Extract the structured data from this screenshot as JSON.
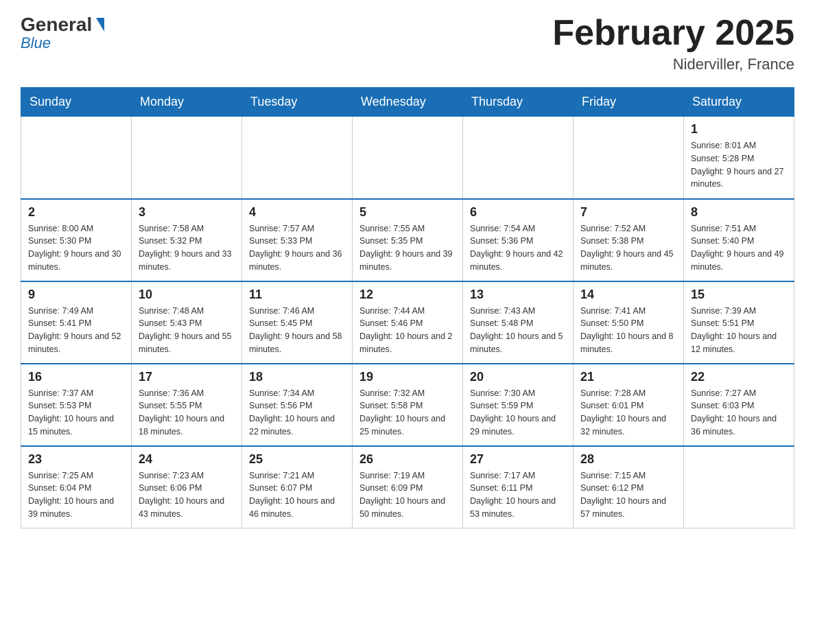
{
  "header": {
    "logo_general": "General",
    "logo_blue": "Blue",
    "month_title": "February 2025",
    "location": "Niderviller, France"
  },
  "weekdays": [
    "Sunday",
    "Monday",
    "Tuesday",
    "Wednesday",
    "Thursday",
    "Friday",
    "Saturday"
  ],
  "weeks": [
    [
      {
        "day": "",
        "info": ""
      },
      {
        "day": "",
        "info": ""
      },
      {
        "day": "",
        "info": ""
      },
      {
        "day": "",
        "info": ""
      },
      {
        "day": "",
        "info": ""
      },
      {
        "day": "",
        "info": ""
      },
      {
        "day": "1",
        "info": "Sunrise: 8:01 AM\nSunset: 5:28 PM\nDaylight: 9 hours and 27 minutes."
      }
    ],
    [
      {
        "day": "2",
        "info": "Sunrise: 8:00 AM\nSunset: 5:30 PM\nDaylight: 9 hours and 30 minutes."
      },
      {
        "day": "3",
        "info": "Sunrise: 7:58 AM\nSunset: 5:32 PM\nDaylight: 9 hours and 33 minutes."
      },
      {
        "day": "4",
        "info": "Sunrise: 7:57 AM\nSunset: 5:33 PM\nDaylight: 9 hours and 36 minutes."
      },
      {
        "day": "5",
        "info": "Sunrise: 7:55 AM\nSunset: 5:35 PM\nDaylight: 9 hours and 39 minutes."
      },
      {
        "day": "6",
        "info": "Sunrise: 7:54 AM\nSunset: 5:36 PM\nDaylight: 9 hours and 42 minutes."
      },
      {
        "day": "7",
        "info": "Sunrise: 7:52 AM\nSunset: 5:38 PM\nDaylight: 9 hours and 45 minutes."
      },
      {
        "day": "8",
        "info": "Sunrise: 7:51 AM\nSunset: 5:40 PM\nDaylight: 9 hours and 49 minutes."
      }
    ],
    [
      {
        "day": "9",
        "info": "Sunrise: 7:49 AM\nSunset: 5:41 PM\nDaylight: 9 hours and 52 minutes."
      },
      {
        "day": "10",
        "info": "Sunrise: 7:48 AM\nSunset: 5:43 PM\nDaylight: 9 hours and 55 minutes."
      },
      {
        "day": "11",
        "info": "Sunrise: 7:46 AM\nSunset: 5:45 PM\nDaylight: 9 hours and 58 minutes."
      },
      {
        "day": "12",
        "info": "Sunrise: 7:44 AM\nSunset: 5:46 PM\nDaylight: 10 hours and 2 minutes."
      },
      {
        "day": "13",
        "info": "Sunrise: 7:43 AM\nSunset: 5:48 PM\nDaylight: 10 hours and 5 minutes."
      },
      {
        "day": "14",
        "info": "Sunrise: 7:41 AM\nSunset: 5:50 PM\nDaylight: 10 hours and 8 minutes."
      },
      {
        "day": "15",
        "info": "Sunrise: 7:39 AM\nSunset: 5:51 PM\nDaylight: 10 hours and 12 minutes."
      }
    ],
    [
      {
        "day": "16",
        "info": "Sunrise: 7:37 AM\nSunset: 5:53 PM\nDaylight: 10 hours and 15 minutes."
      },
      {
        "day": "17",
        "info": "Sunrise: 7:36 AM\nSunset: 5:55 PM\nDaylight: 10 hours and 18 minutes."
      },
      {
        "day": "18",
        "info": "Sunrise: 7:34 AM\nSunset: 5:56 PM\nDaylight: 10 hours and 22 minutes."
      },
      {
        "day": "19",
        "info": "Sunrise: 7:32 AM\nSunset: 5:58 PM\nDaylight: 10 hours and 25 minutes."
      },
      {
        "day": "20",
        "info": "Sunrise: 7:30 AM\nSunset: 5:59 PM\nDaylight: 10 hours and 29 minutes."
      },
      {
        "day": "21",
        "info": "Sunrise: 7:28 AM\nSunset: 6:01 PM\nDaylight: 10 hours and 32 minutes."
      },
      {
        "day": "22",
        "info": "Sunrise: 7:27 AM\nSunset: 6:03 PM\nDaylight: 10 hours and 36 minutes."
      }
    ],
    [
      {
        "day": "23",
        "info": "Sunrise: 7:25 AM\nSunset: 6:04 PM\nDaylight: 10 hours and 39 minutes."
      },
      {
        "day": "24",
        "info": "Sunrise: 7:23 AM\nSunset: 6:06 PM\nDaylight: 10 hours and 43 minutes."
      },
      {
        "day": "25",
        "info": "Sunrise: 7:21 AM\nSunset: 6:07 PM\nDaylight: 10 hours and 46 minutes."
      },
      {
        "day": "26",
        "info": "Sunrise: 7:19 AM\nSunset: 6:09 PM\nDaylight: 10 hours and 50 minutes."
      },
      {
        "day": "27",
        "info": "Sunrise: 7:17 AM\nSunset: 6:11 PM\nDaylight: 10 hours and 53 minutes."
      },
      {
        "day": "28",
        "info": "Sunrise: 7:15 AM\nSunset: 6:12 PM\nDaylight: 10 hours and 57 minutes."
      },
      {
        "day": "",
        "info": ""
      }
    ]
  ]
}
